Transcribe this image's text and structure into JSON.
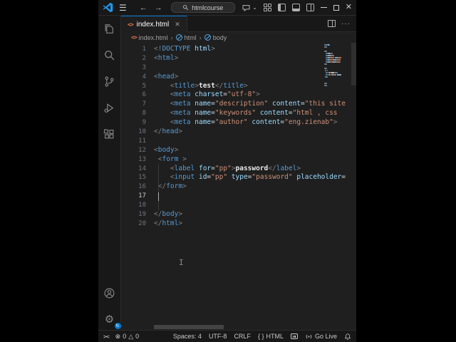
{
  "colors": {
    "accent": "#0078d4",
    "editor_bg": "#1f1f1f",
    "chrome_bg": "#181818",
    "tag": "#569cd6",
    "attribute": "#9cdcfe",
    "string": "#ce9178",
    "html_icon": "#e8774f",
    "settings_badge": "#0078d4"
  },
  "title_bar": {
    "search_value": "htmlcourse",
    "menu_icon": "☰",
    "back_icon": "←",
    "forward_icon": "→",
    "chevron_down": "⌄",
    "close_icon": "✕",
    "icons": [
      "vscode-logo",
      "menu",
      "back",
      "forward",
      "search",
      "chat",
      "customize-layout",
      "toggle-sidebar-left",
      "toggle-panel",
      "toggle-sidebar-right",
      "minimize",
      "maximize",
      "close"
    ]
  },
  "tab_bar": {
    "tabs": [
      {
        "label": "index.html",
        "icon": "html-file",
        "close": "✕",
        "active": true
      }
    ],
    "more_icon": "···"
  },
  "breadcrumb": {
    "chevron": "›",
    "items": [
      {
        "label": "index.html",
        "icon": "html-file"
      },
      {
        "label": "html",
        "icon": "symbol-tag"
      },
      {
        "label": "body",
        "icon": "symbol-tag"
      }
    ]
  },
  "activity_bar": {
    "top_items": [
      "explorer",
      "search",
      "source-control",
      "run-and-debug",
      "extensions"
    ],
    "bottom_items": [
      "accounts",
      "settings"
    ]
  },
  "editor": {
    "language_file_icon": "<>",
    "lines": [
      {
        "n": "1",
        "tokens": [
          {
            "t": "<!",
            "c": "p"
          },
          {
            "t": "DOCTYPE",
            "c": "t"
          },
          {
            "t": " ",
            "c": "w"
          },
          {
            "t": "html",
            "c": "a"
          },
          {
            "t": ">",
            "c": "p"
          }
        ]
      },
      {
        "n": "2",
        "tokens": [
          {
            "t": "<",
            "c": "p"
          },
          {
            "t": "html",
            "c": "t"
          },
          {
            "t": ">",
            "c": "p"
          }
        ]
      },
      {
        "n": "3",
        "tokens": []
      },
      {
        "n": "4",
        "tokens": [
          {
            "t": "<",
            "c": "p"
          },
          {
            "t": "head",
            "c": "t"
          },
          {
            "t": ">",
            "c": "p"
          }
        ]
      },
      {
        "n": "5",
        "tokens": [
          {
            "t": "    ",
            "c": "w"
          },
          {
            "t": "<",
            "c": "p"
          },
          {
            "t": "title",
            "c": "t"
          },
          {
            "t": ">",
            "c": "p"
          },
          {
            "t": "test",
            "c": "x"
          },
          {
            "t": "</",
            "c": "p"
          },
          {
            "t": "title",
            "c": "t"
          },
          {
            "t": ">",
            "c": "p"
          }
        ]
      },
      {
        "n": "6",
        "tokens": [
          {
            "t": "    ",
            "c": "w"
          },
          {
            "t": "<",
            "c": "p"
          },
          {
            "t": "meta",
            "c": "t"
          },
          {
            "t": " ",
            "c": "w"
          },
          {
            "t": "charset",
            "c": "a"
          },
          {
            "t": "=",
            "c": "w"
          },
          {
            "t": "\"utf-8\"",
            "c": "s"
          },
          {
            "t": ">",
            "c": "p"
          }
        ]
      },
      {
        "n": "7",
        "tokens": [
          {
            "t": "    ",
            "c": "w"
          },
          {
            "t": "<",
            "c": "p"
          },
          {
            "t": "meta",
            "c": "t"
          },
          {
            "t": " ",
            "c": "w"
          },
          {
            "t": "name",
            "c": "a"
          },
          {
            "t": "=",
            "c": "w"
          },
          {
            "t": "\"description\"",
            "c": "s"
          },
          {
            "t": " ",
            "c": "w"
          },
          {
            "t": "content",
            "c": "a"
          },
          {
            "t": "=",
            "c": "w"
          },
          {
            "t": "\"this site",
            "c": "s"
          }
        ]
      },
      {
        "n": "8",
        "tokens": [
          {
            "t": "    ",
            "c": "w"
          },
          {
            "t": "<",
            "c": "p"
          },
          {
            "t": "meta",
            "c": "t"
          },
          {
            "t": " ",
            "c": "w"
          },
          {
            "t": "name",
            "c": "a"
          },
          {
            "t": "=",
            "c": "w"
          },
          {
            "t": "\"keywords\"",
            "c": "s"
          },
          {
            "t": " ",
            "c": "w"
          },
          {
            "t": "content",
            "c": "a"
          },
          {
            "t": "=",
            "c": "w"
          },
          {
            "t": "\"html , css ",
            "c": "s"
          }
        ]
      },
      {
        "n": "9",
        "tokens": [
          {
            "t": "    ",
            "c": "w"
          },
          {
            "t": "<",
            "c": "p"
          },
          {
            "t": "meta",
            "c": "t"
          },
          {
            "t": " ",
            "c": "w"
          },
          {
            "t": "name",
            "c": "a"
          },
          {
            "t": "=",
            "c": "w"
          },
          {
            "t": "\"author\"",
            "c": "s"
          },
          {
            "t": " ",
            "c": "w"
          },
          {
            "t": "content",
            "c": "a"
          },
          {
            "t": "=",
            "c": "w"
          },
          {
            "t": "\"eng.zienab\"",
            "c": "s"
          },
          {
            "t": ">",
            "c": "p"
          }
        ]
      },
      {
        "n": "10",
        "tokens": [
          {
            "t": "</",
            "c": "p"
          },
          {
            "t": "head",
            "c": "t"
          },
          {
            "t": ">",
            "c": "p"
          }
        ]
      },
      {
        "n": "11",
        "tokens": []
      },
      {
        "n": "12",
        "tokens": [
          {
            "t": "<",
            "c": "p"
          },
          {
            "t": "body",
            "c": "t"
          },
          {
            "t": ">",
            "c": "p"
          }
        ]
      },
      {
        "n": "13",
        "tokens": [
          {
            "t": " ",
            "c": "w"
          },
          {
            "t": "<",
            "c": "p"
          },
          {
            "t": "form",
            "c": "t"
          },
          {
            "t": " ",
            "c": "w"
          },
          {
            "t": ">",
            "c": "p"
          }
        ]
      },
      {
        "n": "14",
        "tokens": [
          {
            "t": "    ",
            "c": "w"
          },
          {
            "t": "<",
            "c": "p"
          },
          {
            "t": "label",
            "c": "t"
          },
          {
            "t": " ",
            "c": "w"
          },
          {
            "t": "for",
            "c": "a"
          },
          {
            "t": "=",
            "c": "w"
          },
          {
            "t": "\"pp\"",
            "c": "s"
          },
          {
            "t": ">",
            "c": "p"
          },
          {
            "t": "password",
            "c": "x"
          },
          {
            "t": "</",
            "c": "p"
          },
          {
            "t": "label",
            "c": "t"
          },
          {
            "t": ">",
            "c": "p"
          }
        ]
      },
      {
        "n": "15",
        "tokens": [
          {
            "t": "    ",
            "c": "w"
          },
          {
            "t": "<",
            "c": "p"
          },
          {
            "t": "input",
            "c": "t"
          },
          {
            "t": " ",
            "c": "w"
          },
          {
            "t": "id",
            "c": "a"
          },
          {
            "t": "=",
            "c": "w"
          },
          {
            "t": "\"pp\"",
            "c": "s"
          },
          {
            "t": " ",
            "c": "w"
          },
          {
            "t": "type",
            "c": "a"
          },
          {
            "t": "=",
            "c": "w"
          },
          {
            "t": "\"password\"",
            "c": "s"
          },
          {
            "t": " ",
            "c": "w"
          },
          {
            "t": "placeholder",
            "c": "a"
          },
          {
            "t": "=",
            "c": "w"
          }
        ]
      },
      {
        "n": "16",
        "tokens": [
          {
            "t": " ",
            "c": "w"
          },
          {
            "t": "</",
            "c": "p"
          },
          {
            "t": "form",
            "c": "t"
          },
          {
            "t": ">",
            "c": "p"
          }
        ]
      },
      {
        "n": "17",
        "tokens": [],
        "active": true
      },
      {
        "n": "18",
        "tokens": []
      },
      {
        "n": "19",
        "tokens": [
          {
            "t": "</",
            "c": "p"
          },
          {
            "t": "body",
            "c": "t"
          },
          {
            "t": ">",
            "c": "p"
          }
        ]
      },
      {
        "n": "20",
        "tokens": [
          {
            "t": "</",
            "c": "p"
          },
          {
            "t": "html",
            "c": "t"
          },
          {
            "t": ">",
            "c": "p"
          }
        ]
      }
    ]
  },
  "status_bar": {
    "remote_icon": "><",
    "error_icon": "⊗",
    "error_count": "0",
    "warning_icon": "△",
    "warning_count": "0",
    "spaces": "Spaces: 4",
    "encoding": "UTF-8",
    "eol": "CRLF",
    "language_icon": "{ }",
    "language": "HTML",
    "go_live": "Go Live"
  }
}
